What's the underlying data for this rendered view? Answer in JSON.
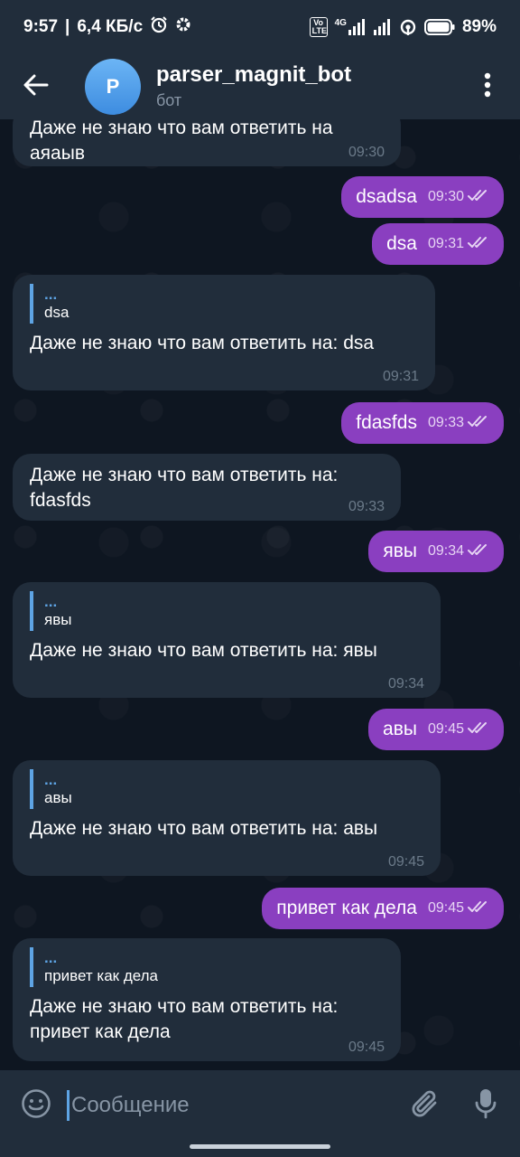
{
  "status_bar": {
    "time": "9:57",
    "network_speed": "6,4 КБ/с",
    "signal_label": "4G",
    "volte_label": "Vo LTE",
    "battery": "89%"
  },
  "header": {
    "back_icon": "arrow-left-icon",
    "avatar_letter": "P",
    "title": "parser_magnit_bot",
    "subtitle": "бот",
    "menu_icon": "more-vertical-icon"
  },
  "messages": [
    {
      "dir": "in",
      "text": "Даже не знаю что вам ответить на\nаяаыв",
      "time": "09:30"
    },
    {
      "dir": "out",
      "text": "dsadsa",
      "time": "09:30"
    },
    {
      "dir": "out",
      "text": "dsa",
      "time": "09:31"
    },
    {
      "dir": "in",
      "quote_name": "...",
      "quote_text": "dsa",
      "text": "Даже не знаю что вам ответить на: dsa",
      "time": "09:31"
    },
    {
      "dir": "out",
      "text": "fdasfds",
      "time": "09:33"
    },
    {
      "dir": "in",
      "text": "Даже не знаю что вам ответить на:\nfdasfds",
      "time": "09:33"
    },
    {
      "dir": "out",
      "text": "явы",
      "time": "09:34"
    },
    {
      "dir": "in",
      "quote_name": "...",
      "quote_text": "явы",
      "text": "Даже не знаю что вам ответить на: явы",
      "time": "09:34"
    },
    {
      "dir": "out",
      "text": "авы",
      "time": "09:45"
    },
    {
      "dir": "in",
      "quote_name": "...",
      "quote_text": "авы",
      "text": "Даже не знаю что вам ответить на: авы",
      "time": "09:45"
    },
    {
      "dir": "out",
      "text": "привет как дела",
      "time": "09:45"
    },
    {
      "dir": "in",
      "quote_name": "...",
      "quote_text": "привет как дела",
      "text": "Даже не знаю что вам ответить на:\nпривет как дела",
      "time": "09:45"
    }
  ],
  "input_bar": {
    "placeholder": "Сообщение",
    "emoji_icon": "emoji-icon",
    "attach_icon": "paperclip-icon",
    "mic_icon": "microphone-icon"
  },
  "colors": {
    "background": "#0e1621",
    "panel": "#212d3b",
    "incoming_bubble": "#212d3b",
    "outgoing_bubble": "#8a3fc0",
    "accent": "#5ea4e4"
  }
}
